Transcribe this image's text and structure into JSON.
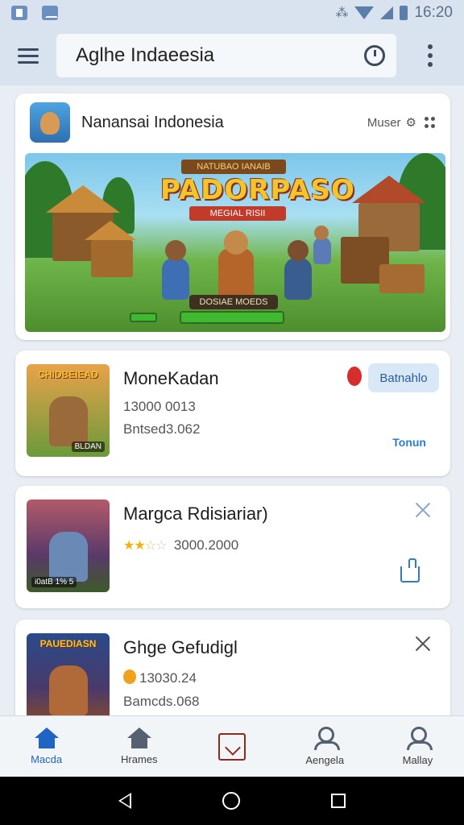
{
  "status_bar": {
    "time": "16:20"
  },
  "top_bar": {
    "search_text": "Aglhe Indaeesia"
  },
  "feature": {
    "title": "Nanansai Indonesia",
    "user": "Muser",
    "banner_top": "NATUBAO IANAIB",
    "banner_title": "PADORPASO",
    "banner_sub": "MEGIAL RISII",
    "banner_label": "DOSIAE MOEDS",
    "progress": 1.0
  },
  "items": [
    {
      "title": "MoneKadan",
      "line1": "13000 0013",
      "line2": "Bntsed3.062",
      "thumb_label": "CHIDBEIEAD",
      "thumb_foot": "BLDAN",
      "action": "Batnahlo",
      "corner": "Tonun"
    },
    {
      "title": "Margca Rdisiariar)",
      "rating_text": "3000.2000",
      "stars_filled": 2.5,
      "stars_total": 5,
      "thumb_foot": "i0atB 1% 5"
    },
    {
      "title": "Ghge Gefudigl",
      "line1": "13030.24",
      "line2": "Bamcds.068",
      "thumb_label": "PAUEDIASN"
    }
  ],
  "bottom_nav": [
    {
      "label": "Macda"
    },
    {
      "label": "Hrames"
    },
    {
      "label": ""
    },
    {
      "label": "Aengela"
    },
    {
      "label": "Mallay"
    }
  ]
}
